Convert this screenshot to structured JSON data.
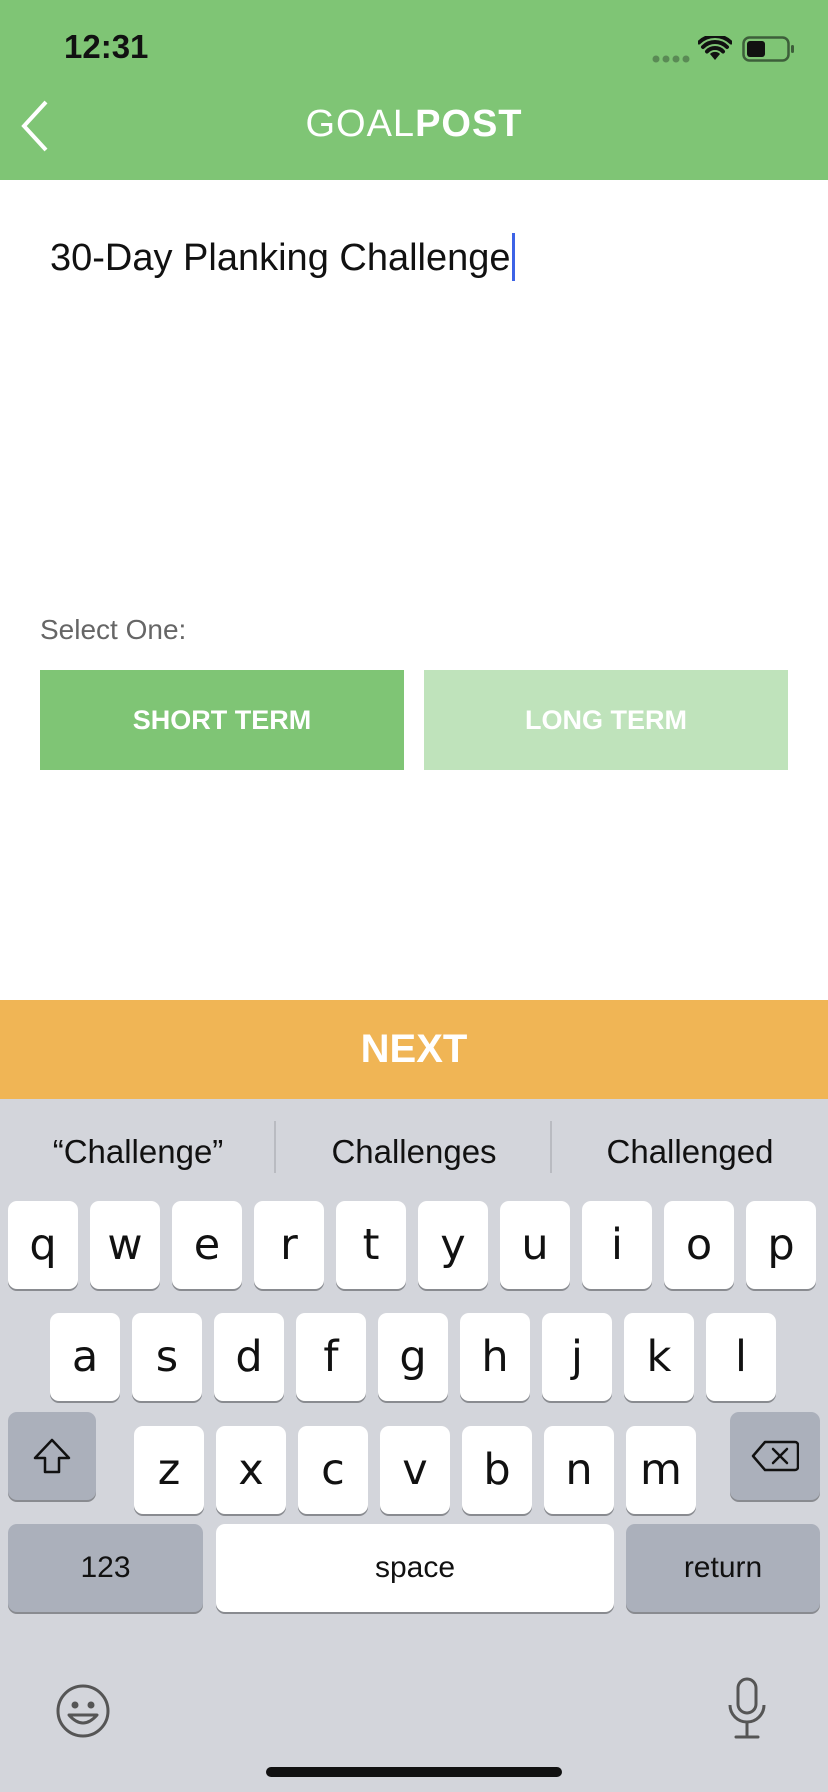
{
  "status_bar": {
    "time": "12:31",
    "battery_level": 0.5
  },
  "header": {
    "title_light": "GOAL",
    "title_bold": "POST",
    "back_icon": "chevron-left-icon",
    "color": "#7fc575"
  },
  "goal": {
    "title_value": "30-Day Planking Challenge"
  },
  "selection": {
    "label": "Select One:",
    "options": [
      {
        "label": "SHORT TERM",
        "selected": true
      },
      {
        "label": "LONG TERM",
        "selected": false
      }
    ]
  },
  "next_button": {
    "label": "NEXT",
    "color": "#f0b555"
  },
  "keyboard": {
    "suggestions": [
      "“Challenge”",
      "Challenges",
      "Challenged"
    ],
    "row1": [
      "q",
      "w",
      "e",
      "r",
      "t",
      "y",
      "u",
      "i",
      "o",
      "p"
    ],
    "row2": [
      "a",
      "s",
      "d",
      "f",
      "g",
      "h",
      "j",
      "k",
      "l"
    ],
    "row3": [
      "z",
      "x",
      "c",
      "v",
      "b",
      "n",
      "m"
    ],
    "numbers_label": "123",
    "space_label": "space",
    "return_label": "return",
    "shift_icon": "shift-icon",
    "delete_icon": "delete-icon",
    "emoji_icon": "emoji-icon",
    "mic_icon": "microphone-icon"
  }
}
